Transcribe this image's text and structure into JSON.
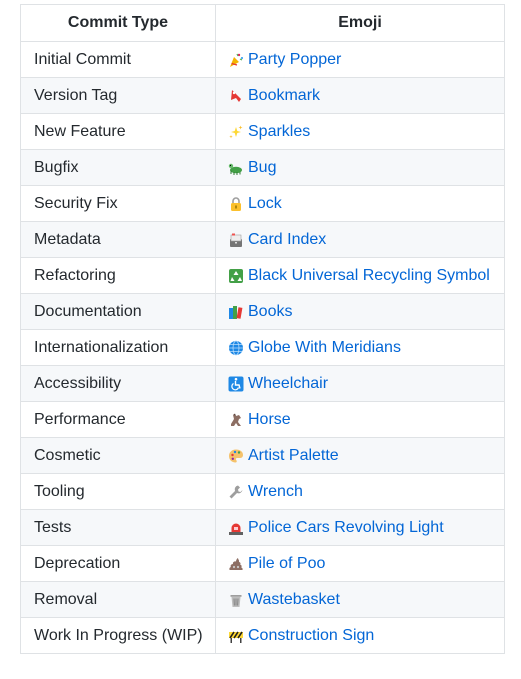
{
  "table": {
    "headers": [
      "Commit Type",
      "Emoji"
    ],
    "rows": [
      {
        "type": "Initial Commit",
        "emoji_name": "Party Popper",
        "icon": "party-popper-icon"
      },
      {
        "type": "Version Tag",
        "emoji_name": "Bookmark",
        "icon": "bookmark-icon"
      },
      {
        "type": "New Feature",
        "emoji_name": "Sparkles",
        "icon": "sparkles-icon"
      },
      {
        "type": "Bugfix",
        "emoji_name": "Bug",
        "icon": "bug-icon"
      },
      {
        "type": "Security Fix",
        "emoji_name": "Lock",
        "icon": "lock-icon"
      },
      {
        "type": "Metadata",
        "emoji_name": "Card Index",
        "icon": "card-index-icon"
      },
      {
        "type": "Refactoring",
        "emoji_name": "Black Universal Recycling Symbol",
        "icon": "recycling-icon"
      },
      {
        "type": "Documentation",
        "emoji_name": "Books",
        "icon": "books-icon"
      },
      {
        "type": "Internationalization",
        "emoji_name": "Globe With Meridians",
        "icon": "globe-icon"
      },
      {
        "type": "Accessibility",
        "emoji_name": "Wheelchair",
        "icon": "wheelchair-icon"
      },
      {
        "type": "Performance",
        "emoji_name": "Horse",
        "icon": "horse-icon"
      },
      {
        "type": "Cosmetic",
        "emoji_name": "Artist Palette",
        "icon": "palette-icon"
      },
      {
        "type": "Tooling",
        "emoji_name": "Wrench",
        "icon": "wrench-icon"
      },
      {
        "type": "Tests",
        "emoji_name": "Police Cars Revolving Light",
        "icon": "police-light-icon"
      },
      {
        "type": "Deprecation",
        "emoji_name": "Pile of Poo",
        "icon": "poo-icon"
      },
      {
        "type": "Removal",
        "emoji_name": "Wastebasket",
        "icon": "wastebasket-icon"
      },
      {
        "type": "Work In Progress (WIP)",
        "emoji_name": "Construction Sign",
        "icon": "construction-icon"
      }
    ]
  },
  "colors": {
    "link": "#0366d6",
    "border": "#dfe2e5",
    "stripe": "#f6f8fa",
    "text": "#24292e"
  }
}
